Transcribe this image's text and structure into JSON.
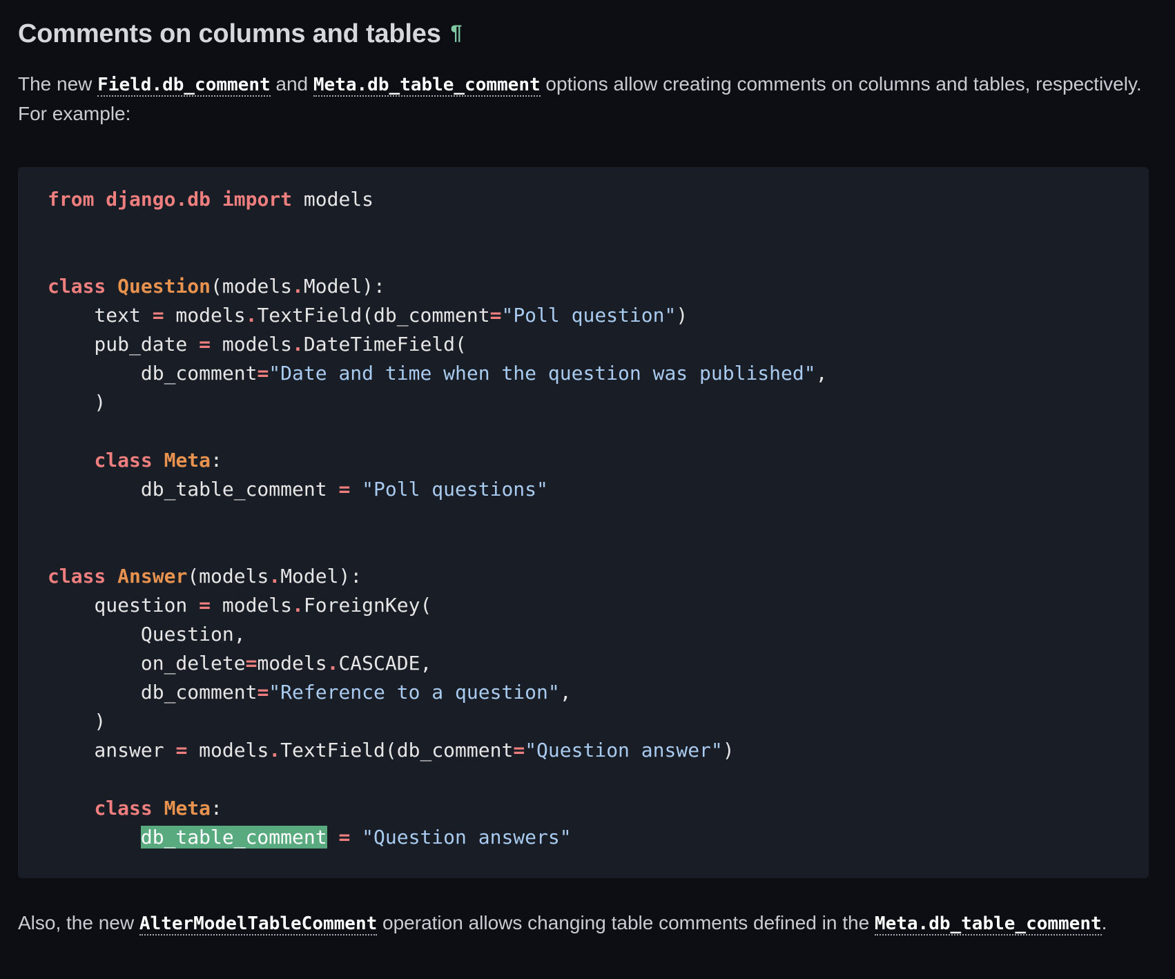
{
  "heading": {
    "title": "Comments on columns and tables",
    "anchor": "¶"
  },
  "intro": {
    "text_1": "The new ",
    "link_1": "Field.db_comment",
    "text_2": " and ",
    "link_2": "Meta.db_table_comment",
    "text_3": " options allow creating comments on columns and tables, respectively. For example:"
  },
  "code": {
    "language": "python",
    "lines": [
      "from django.db import models",
      "",
      "",
      "class Question(models.Model):",
      "    text = models.TextField(db_comment=\"Poll question\")",
      "    pub_date = models.DateTimeField(",
      "        db_comment=\"Date and time when the question was published\",",
      "    )",
      "",
      "    class Meta:",
      "        db_table_comment = \"Poll questions\"",
      "",
      "",
      "class Answer(models.Model):",
      "    question = models.ForeignKey(",
      "        Question,",
      "        on_delete=models.CASCADE,",
      "        db_comment=\"Reference to a question\",",
      "    )",
      "    answer = models.TextField(db_comment=\"Question answer\")",
      "",
      "    class Meta:",
      "        db_table_comment = \"Question answers\""
    ],
    "highlighted_token": "db_table_comment",
    "highlight_color": "#5aaa80"
  },
  "outro": {
    "text_1": "Also, the new ",
    "link_1": "AlterModelTableComment",
    "text_2": " operation allows changing table comments defined in the ",
    "link_2": "Meta.db_table_comment",
    "text_3": "."
  },
  "colors": {
    "background": "#0c0e13",
    "code_background": "#191d25",
    "keyword": "#ef7f7f",
    "class_name": "#e8924f",
    "string": "#a9cbf0",
    "anchor": "#7fc8a3"
  }
}
